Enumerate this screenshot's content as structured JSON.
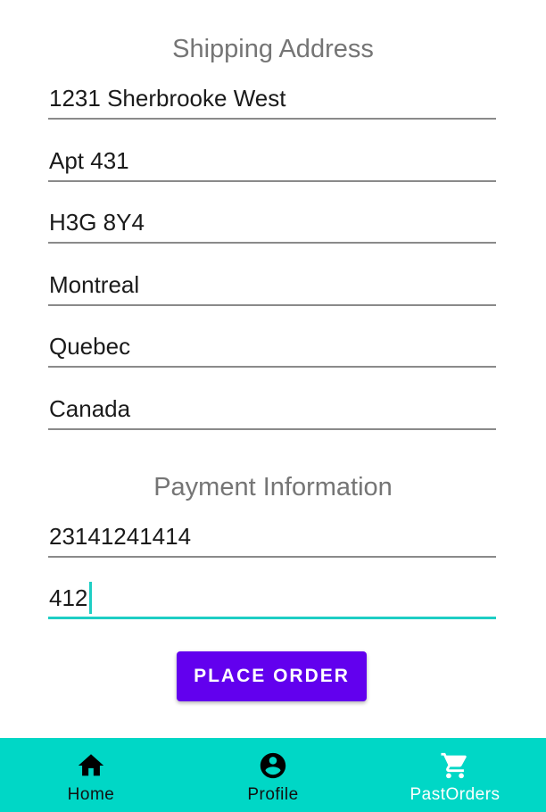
{
  "shipping": {
    "title": "Shipping Address",
    "fields": [
      {
        "value": "1231 Sherbrooke West"
      },
      {
        "value": "Apt 431"
      },
      {
        "value": "H3G 8Y4"
      },
      {
        "value": "Montreal"
      },
      {
        "value": "Quebec"
      },
      {
        "value": "Canada"
      }
    ]
  },
  "payment": {
    "title": "Payment Information",
    "fields": [
      {
        "value": "23141241414"
      },
      {
        "value": "412"
      }
    ]
  },
  "actions": {
    "place_order_label": "PLACE ORDER"
  },
  "bottom_nav": {
    "items": [
      {
        "label": "Home",
        "icon": "home-icon"
      },
      {
        "label": "Profile",
        "icon": "account-circle-icon"
      },
      {
        "label": "PastOrders",
        "icon": "cart-icon",
        "active": true
      }
    ]
  },
  "colors": {
    "accent": "#6200ee",
    "nav_background": "#00d7c6",
    "focus_line": "#1ecec4"
  }
}
